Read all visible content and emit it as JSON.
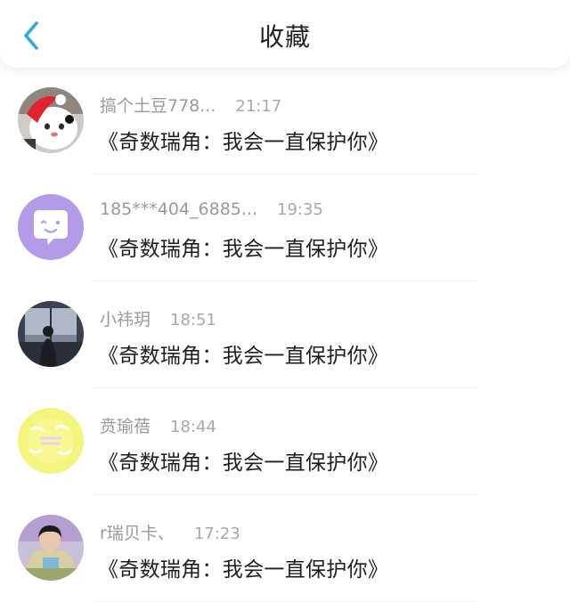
{
  "header": {
    "title": "收藏",
    "back_icon": "chevron-left-icon",
    "accent_color": "#2fa6e8"
  },
  "items": [
    {
      "name": "搞个土豆778...",
      "time": "21:17",
      "content": "《奇数瑞角：我会一直保护你》",
      "avatar_icon": "plush-toy-avatar"
    },
    {
      "name": "185***404_6885...",
      "time": "19:35",
      "content": "《奇数瑞角：我会一直保护你》",
      "avatar_icon": "chat-bubble-default-avatar"
    },
    {
      "name": "小祎玥",
      "time": "18:51",
      "content": "《奇数瑞角：我会一直保护你》",
      "avatar_icon": "window-silhouette-avatar"
    },
    {
      "name": "贲瑜蓓",
      "time": "18:44",
      "content": "《奇数瑞角：我会一直保护你》",
      "avatar_icon": "yellow-sticker-avatar"
    },
    {
      "name": "r瑞贝卡、",
      "time": "17:23",
      "content": "《奇数瑞角：我会一直保护你》",
      "avatar_icon": "girl-photo-avatar"
    }
  ]
}
